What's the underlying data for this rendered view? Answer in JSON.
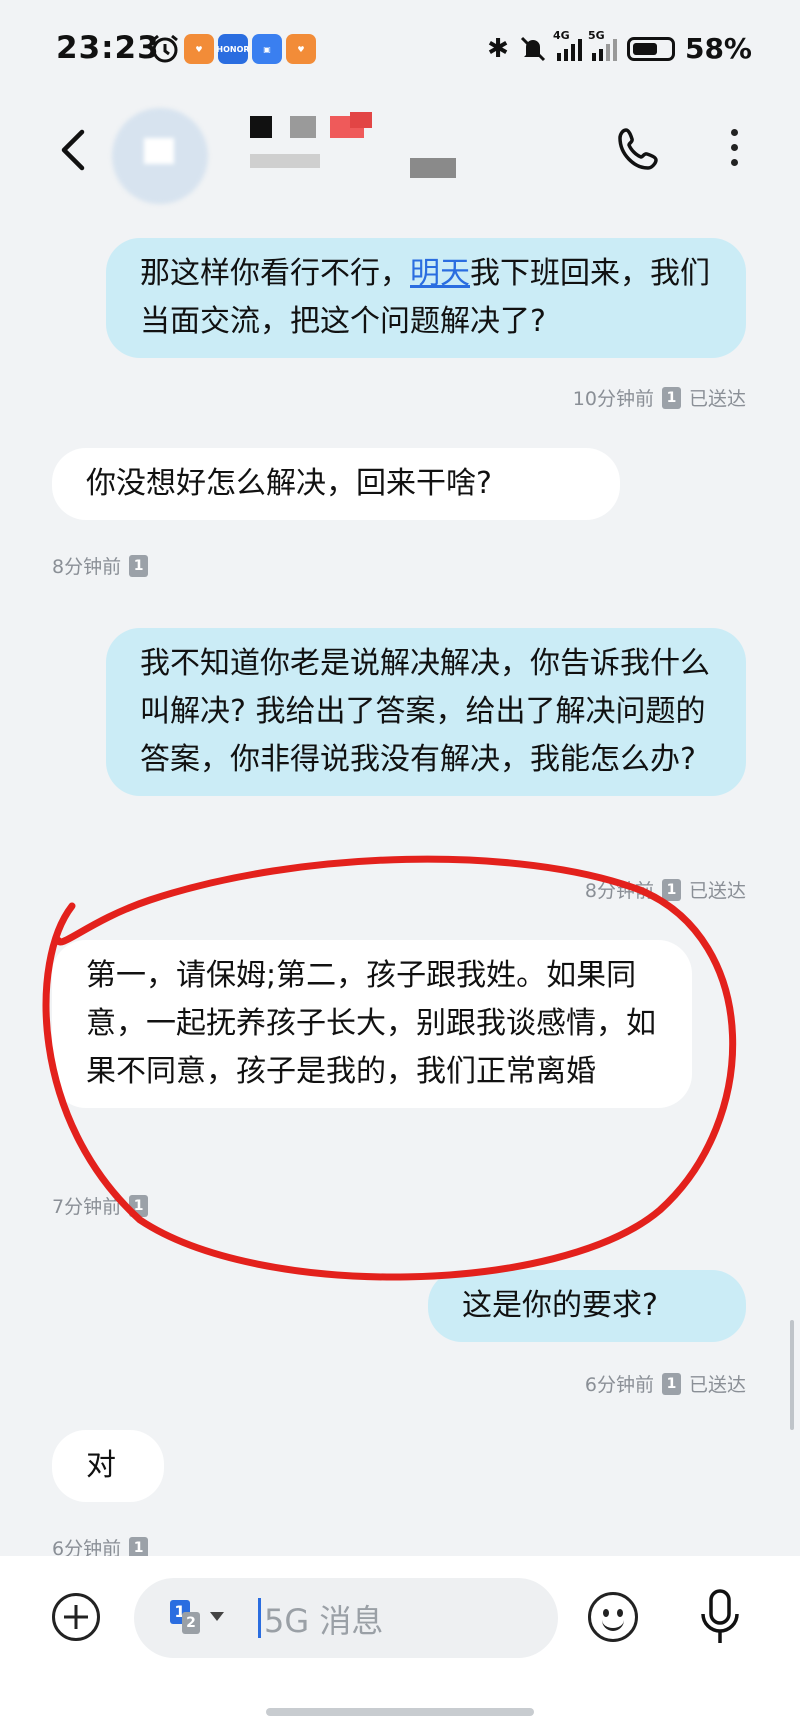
{
  "status_bar": {
    "time": "23:23",
    "apps": [
      "alarm-icon",
      "honor-app-icon",
      "honor-icon",
      "app-market-icon",
      "honor-app-icon"
    ],
    "honor_text": "HONOR",
    "net1": "4G",
    "net2": "5G",
    "battery": "58%",
    "battery_level": 0.58
  },
  "header": {
    "contact_name": "",
    "back_icon": "chevron-left-icon",
    "call_icon": "phone-icon",
    "more_icon": "more-vertical-icon"
  },
  "messages": [
    {
      "dir": "out",
      "text_before": "那这样你看行不行，",
      "link": "明天",
      "text_after": "我下班回来，我们当面交流，把这个问题解决了?",
      "time": "10分钟前",
      "sim": "1",
      "status": "已送达"
    },
    {
      "dir": "in",
      "text": "你没想好怎么解决，回来干啥?",
      "time": "8分钟前",
      "sim": "1"
    },
    {
      "dir": "out",
      "text": "我不知道你老是说解决解决，你告诉我什么叫解决? 我给出了答案，给出了解决问题的答案，你非得说我没有解决，我能怎么办?",
      "time": "8分钟前",
      "sim": "1",
      "status": "已送达"
    },
    {
      "dir": "in",
      "text": "第一，请保姆;第二，孩子跟我姓。如果同意，一起抚养孩子长大，别跟我谈感情，如果不同意，孩子是我的，我们正常离婚",
      "time": "7分钟前",
      "sim": "1",
      "annotated": true
    },
    {
      "dir": "out",
      "text": "这是你的要求?",
      "time": "6分钟前",
      "sim": "1",
      "status": "已送达"
    },
    {
      "dir": "in",
      "text": "对",
      "time": "6分钟前",
      "sim": "1"
    }
  ],
  "composer": {
    "placeholder": "5G 消息",
    "sim_primary": "1",
    "sim_secondary": "2",
    "add_icon": "plus-circle-icon",
    "emoji_icon": "emoji-icon",
    "mic_icon": "microphone-icon"
  },
  "colors": {
    "background": "#f1f3f5",
    "outgoing_bubble": "#cbecf6",
    "incoming_bubble": "#ffffff",
    "link": "#2a6de0",
    "annotation": "#e3211c"
  }
}
